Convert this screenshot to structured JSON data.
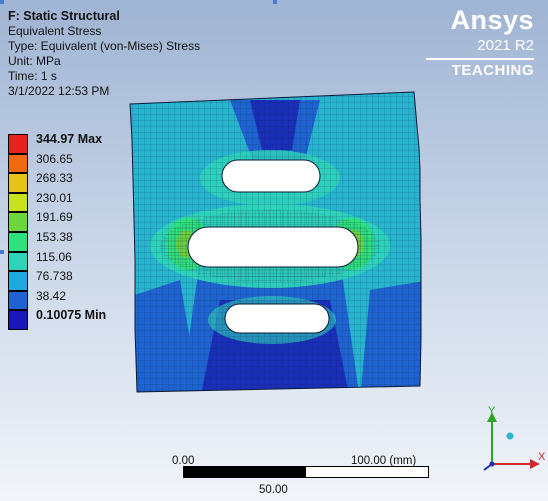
{
  "result_info": {
    "title": "F: Static Structural",
    "result": "Equivalent Stress",
    "type": "Type: Equivalent (von-Mises) Stress",
    "unit": "Unit: MPa",
    "time": "Time: 1 s",
    "date": "3/1/2022 12:53 PM"
  },
  "brand": {
    "name": "Ansys",
    "version": "2021 R2",
    "edition": "TEACHING"
  },
  "legend": {
    "entries": [
      {
        "label": "344.97 Max",
        "color": "#e8221c"
      },
      {
        "label": "306.65",
        "color": "#f06a12"
      },
      {
        "label": "268.33",
        "color": "#e8c317"
      },
      {
        "label": "230.01",
        "color": "#c6e21a"
      },
      {
        "label": "191.69",
        "color": "#6ad53c"
      },
      {
        "label": "153.38",
        "color": "#2fe07d"
      },
      {
        "label": "115.06",
        "color": "#2fd4b8"
      },
      {
        "label": "76.738",
        "color": "#1fa9dc"
      },
      {
        "label": "38.42",
        "color": "#1e63cf"
      },
      {
        "label": "0.10075 Min",
        "color": "#1a17b8"
      }
    ]
  },
  "scale": {
    "left": "0.00",
    "right": "100.00 (mm)",
    "mid": "50.00"
  },
  "triad": {
    "y_label": "Y",
    "x_label": "X"
  }
}
